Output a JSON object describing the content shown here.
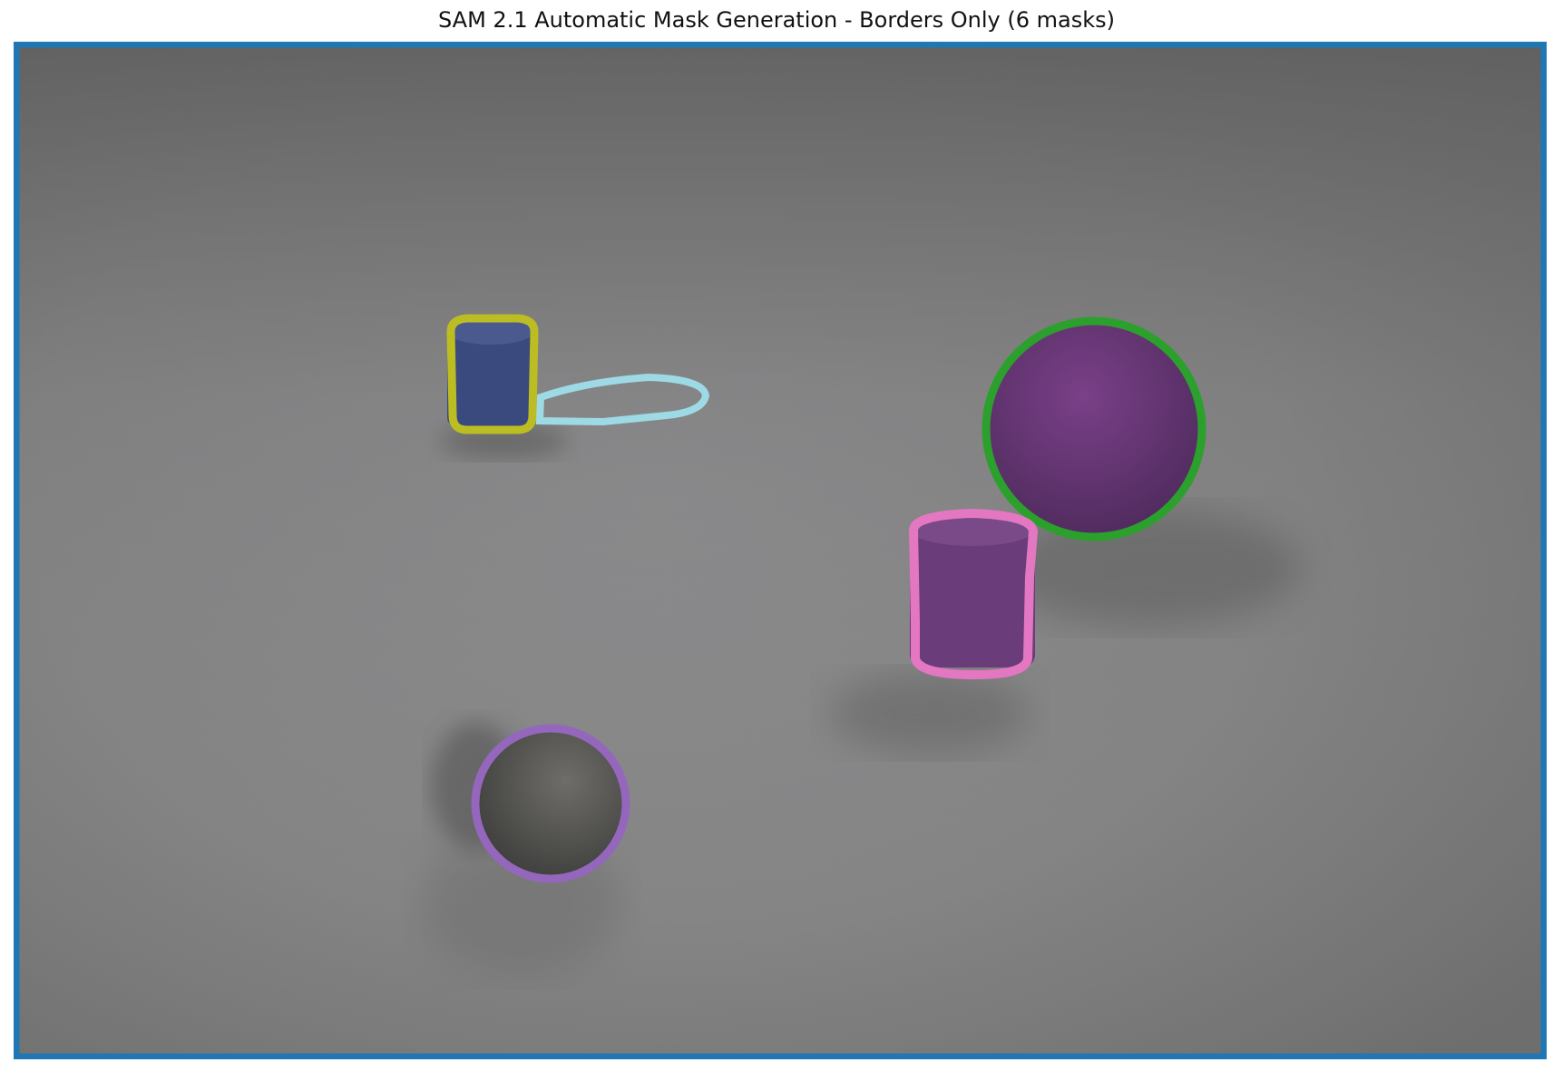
{
  "title": "SAM 2.1 Automatic Mask Generation - Borders Only (6 masks)",
  "mask_count": 6,
  "colors": {
    "background_mask_border": "#1f77b4",
    "yellow_cylinder_border": "#bcbd22",
    "cyan_shadow_border": "#9edae5",
    "green_sphere_border": "#2ca02c",
    "pink_cylinder_border": "#e377c2",
    "purple_sphere_border": "#9467bd",
    "blue_cylinder_fill": "#3a4a7e",
    "purple_sphere_fill": "#6a3878",
    "purple_cylinder_fill": "#6a3c7a",
    "gray_sphere_fill": "#5a5a58"
  }
}
